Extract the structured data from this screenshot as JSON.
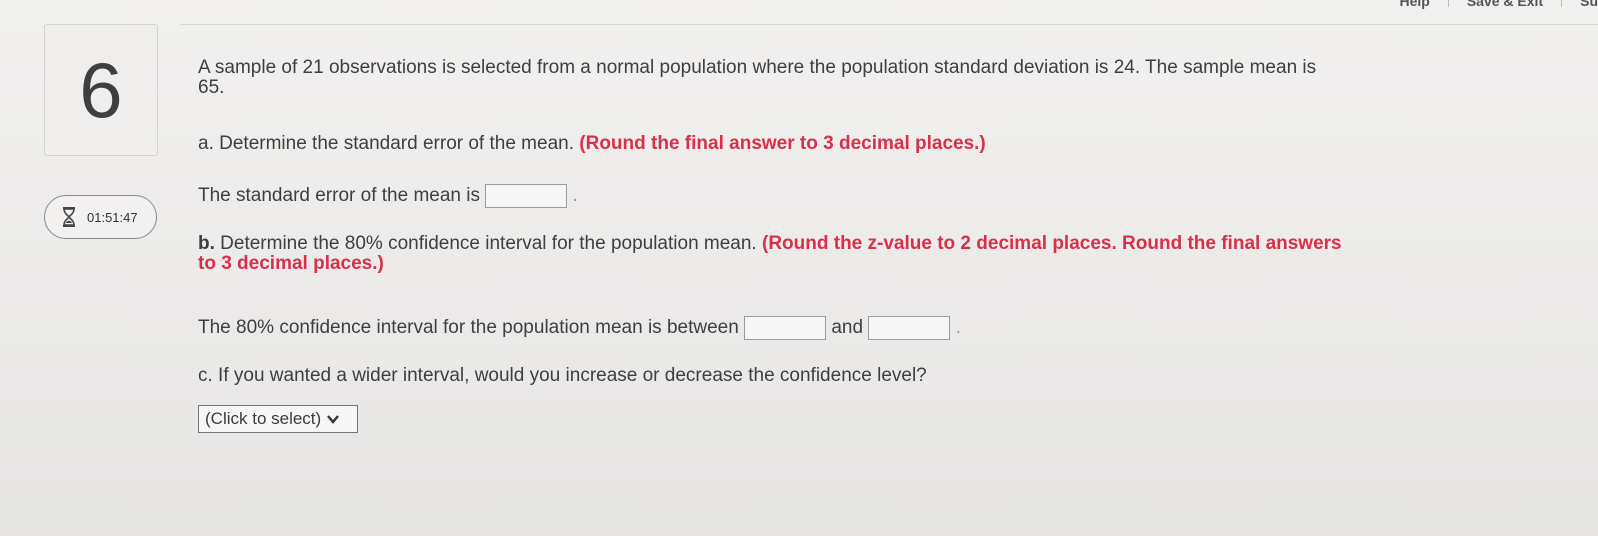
{
  "nav": {
    "help": "Help",
    "save_exit": "Save & Exit",
    "submit": "Su"
  },
  "question": {
    "number": "6"
  },
  "timer": {
    "value": "01:51:47",
    "icon": "hourglass-icon"
  },
  "problem": {
    "intro_line1": "A sample of 21 observations is selected from a normal population where the population standard deviation is 24. The sample mean is",
    "intro_line2": "65.",
    "part_a_label": "a.",
    "part_a_text": " Determine the standard error of the mean. ",
    "part_a_note": "(Round the final answer to 3 decimal places.)",
    "part_a_answer_prefix": "The standard error of the mean is",
    "part_a_answer_value": "",
    "part_b_label": "b.",
    "part_b_text": " Determine the 80% confidence interval for the population mean. ",
    "part_b_note_line1": "(Round the z-value to 2 decimal places. Round the final answers",
    "part_b_note_line2": "to 3 decimal places.)",
    "part_b_answer_prefix": "The 80% confidence interval for the population mean is between",
    "part_b_and": "and",
    "part_b_lower_value": "",
    "part_b_upper_value": "",
    "part_c_label": "c.",
    "part_c_text": " If you wanted a wider interval, would you increase or decrease the confidence level?",
    "part_c_select": "(Click to select)"
  },
  "colors": {
    "emphasis": "#d9304a",
    "text": "#3e3e3e"
  }
}
